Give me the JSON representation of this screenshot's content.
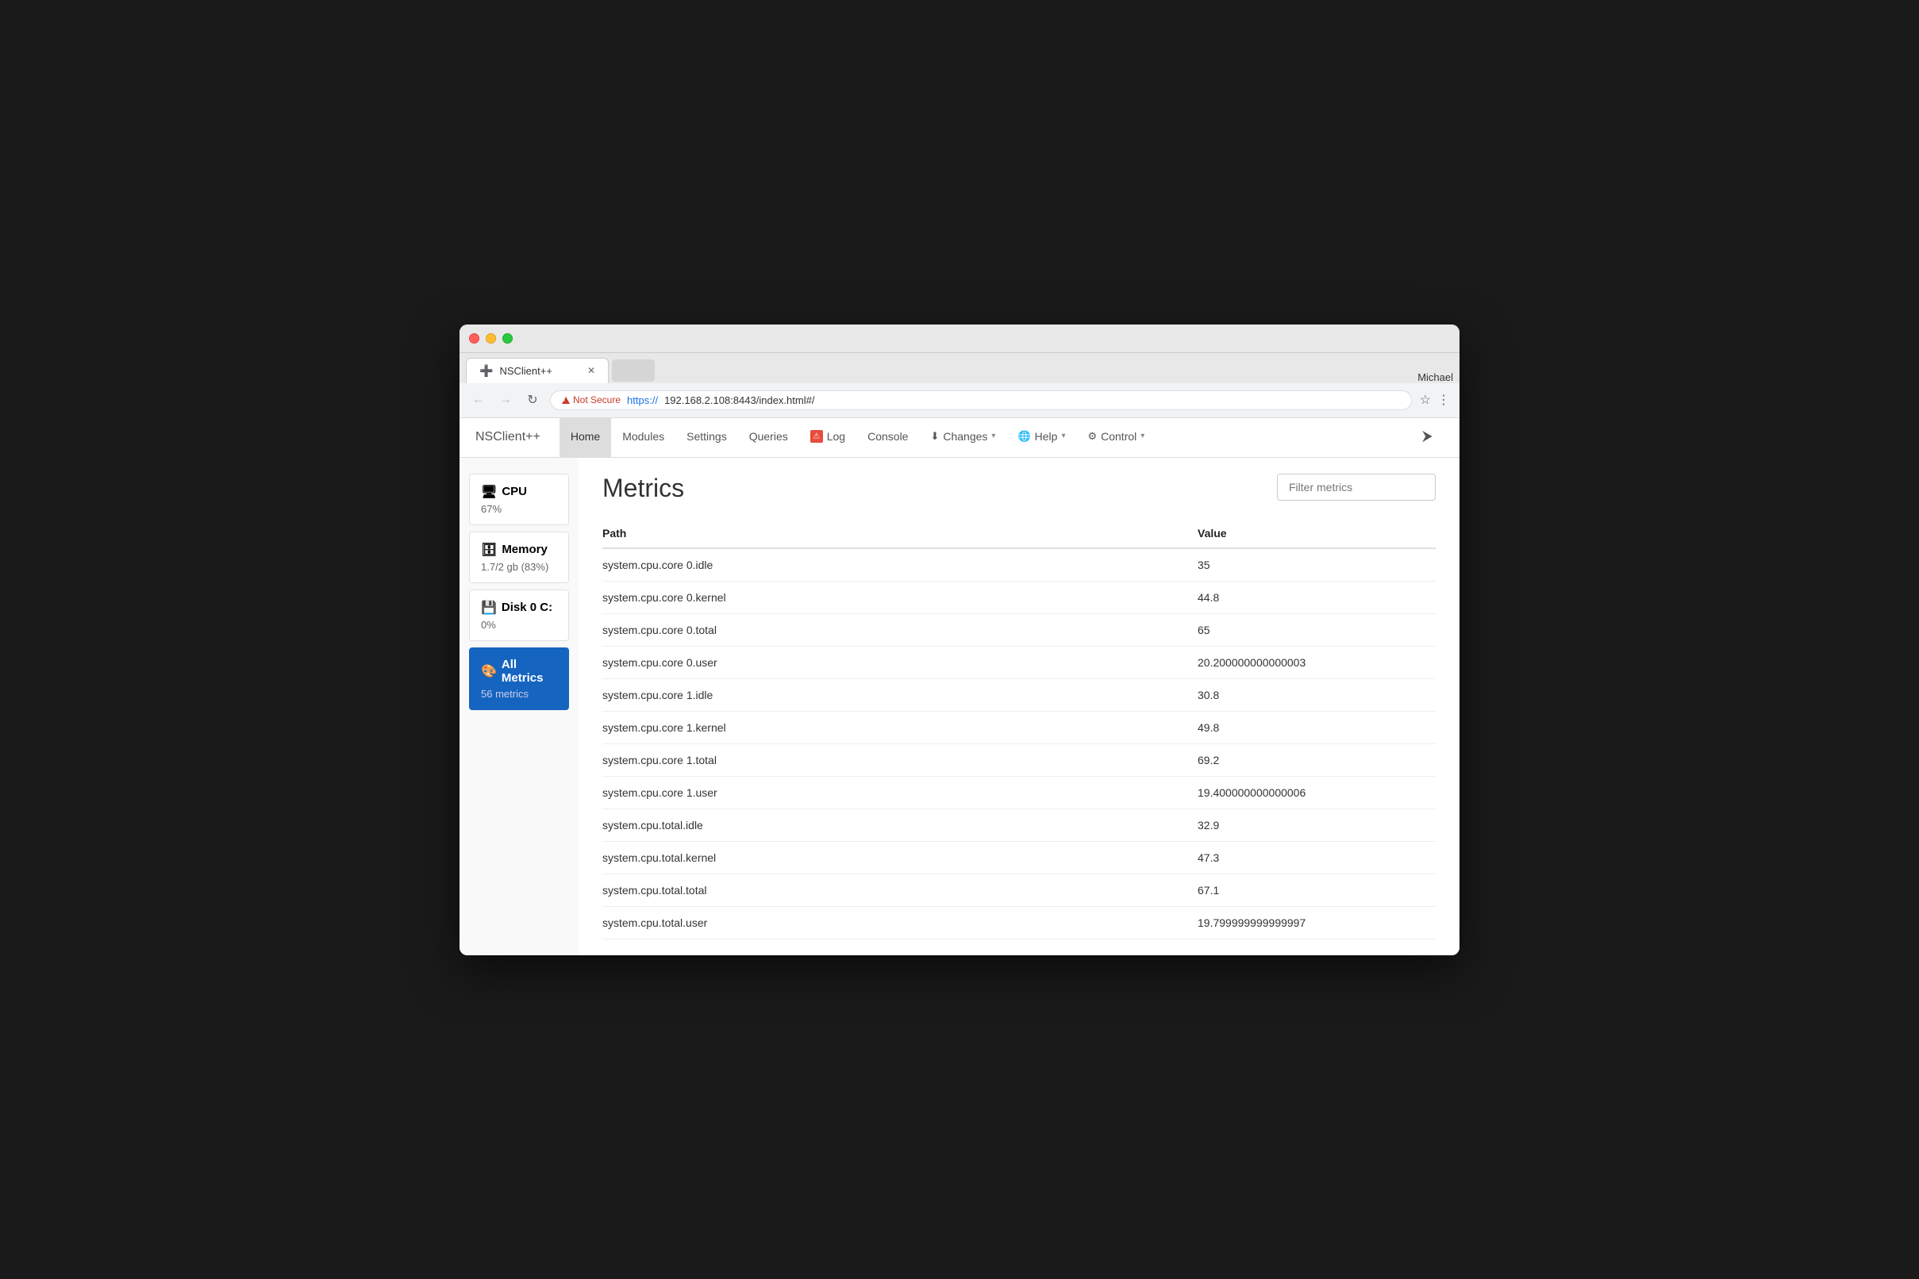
{
  "browser": {
    "tab_title": "NSClient++",
    "tab_icon": "➕",
    "user": "Michael",
    "not_secure_text": "Not Secure",
    "url_https": "https://",
    "url_rest": "192.168.2.108:8443/index.html#/",
    "new_tab_placeholder": ""
  },
  "navbar": {
    "brand": "NSClient++",
    "items": [
      {
        "label": "Home",
        "active": true,
        "icon": "",
        "dropdown": false
      },
      {
        "label": "Modules",
        "active": false,
        "icon": "",
        "dropdown": false
      },
      {
        "label": "Settings",
        "active": false,
        "icon": "",
        "dropdown": false
      },
      {
        "label": "Queries",
        "active": false,
        "icon": "",
        "dropdown": false
      },
      {
        "label": "Log",
        "active": false,
        "icon": "log",
        "dropdown": false
      },
      {
        "label": "Console",
        "active": false,
        "icon": "",
        "dropdown": false
      },
      {
        "label": "Changes",
        "active": false,
        "icon": "download",
        "dropdown": true
      },
      {
        "label": "Help",
        "active": false,
        "icon": "globe",
        "dropdown": true
      },
      {
        "label": "Control",
        "active": false,
        "icon": "gear",
        "dropdown": true
      }
    ]
  },
  "sidebar": {
    "cards": [
      {
        "id": "cpu",
        "title": "CPU",
        "subtitle": "67%",
        "icon": "🖥",
        "active": false
      },
      {
        "id": "memory",
        "title": "Memory",
        "subtitle": "1.7/2 gb (83%)",
        "icon": "🗄",
        "active": false
      },
      {
        "id": "disk",
        "title": "Disk 0 C:",
        "subtitle": "0%",
        "icon": "💾",
        "active": false
      },
      {
        "id": "all",
        "title": "All Metrics",
        "subtitle": "56 metrics",
        "icon": "🎨",
        "active": true
      }
    ]
  },
  "content": {
    "title": "Metrics",
    "filter_placeholder": "Filter metrics",
    "table": {
      "col_path": "Path",
      "col_value": "Value",
      "rows": [
        {
          "path": "system.cpu.core 0.idle",
          "value": "35"
        },
        {
          "path": "system.cpu.core 0.kernel",
          "value": "44.8"
        },
        {
          "path": "system.cpu.core 0.total",
          "value": "65"
        },
        {
          "path": "system.cpu.core 0.user",
          "value": "20.200000000000003"
        },
        {
          "path": "system.cpu.core 1.idle",
          "value": "30.8"
        },
        {
          "path": "system.cpu.core 1.kernel",
          "value": "49.8"
        },
        {
          "path": "system.cpu.core 1.total",
          "value": "69.2"
        },
        {
          "path": "system.cpu.core 1.user",
          "value": "19.400000000000006"
        },
        {
          "path": "system.cpu.total.idle",
          "value": "32.9"
        },
        {
          "path": "system.cpu.total.kernel",
          "value": "47.3"
        },
        {
          "path": "system.cpu.total.total",
          "value": "67.1"
        },
        {
          "path": "system.cpu.total.user",
          "value": "19.799999999999997"
        }
      ]
    }
  }
}
